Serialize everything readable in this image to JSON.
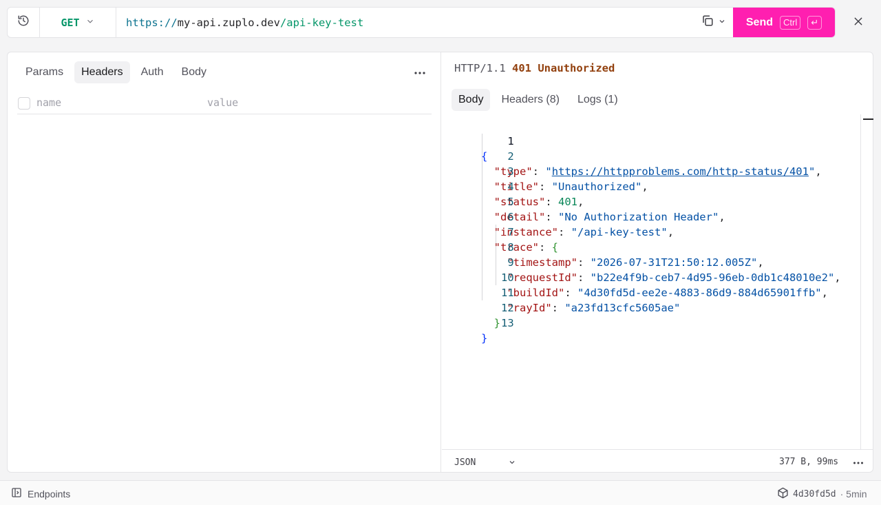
{
  "request": {
    "method": "GET",
    "url_scheme": "https://",
    "url_host": "my-api.zuplo.dev",
    "url_path": "/api-key-test",
    "send_label": "Send",
    "send_shortcut": "Ctrl",
    "send_shortcut_key": "↵"
  },
  "request_tabs": [
    {
      "label": "Params",
      "active": false
    },
    {
      "label": "Headers",
      "active": true
    },
    {
      "label": "Auth",
      "active": false
    },
    {
      "label": "Body",
      "active": false
    }
  ],
  "headers_table": {
    "name_placeholder": "name",
    "value_placeholder": "value"
  },
  "response": {
    "protocol": "HTTP/1.1",
    "status_code": "401",
    "status_text": "Unauthorized",
    "tabs": [
      {
        "label": "Body",
        "active": true
      },
      {
        "label": "Headers (8)",
        "active": false
      },
      {
        "label": "Logs (1)",
        "active": false
      }
    ],
    "line_numbers": [
      "1",
      "2",
      "3",
      "4",
      "5",
      "6",
      "7",
      "8",
      "9",
      "10",
      "11",
      "12",
      "13"
    ],
    "body": {
      "type": "https://httpproblems.com/http-status/401",
      "title": "Unauthorized",
      "status": "401",
      "detail": "No Authorization Header",
      "instance": "/api-key-test",
      "trace": {
        "timestamp": "2026-07-31T21:50:12.005Z",
        "requestId": "b22e4f9b-ceb7-4d95-96eb-0db1c48010e2",
        "buildId": "4d30fd5d-ee2e-4883-86d9-884d65901ffb",
        "rayId": "a23fd13cfc5605ae"
      }
    },
    "format": "JSON",
    "size_time": "377 B, 99ms"
  },
  "statusbar": {
    "endpoints_label": "Endpoints",
    "build_hash": "4d30fd5d",
    "build_age": "· 5min"
  },
  "colors": {
    "send_button": "#ff1fb0",
    "method_get": "#059669",
    "status_code": "#92400e"
  },
  "icons": [
    "history-icon",
    "chevron-down-icon",
    "copy-icon",
    "close-icon",
    "more-horizontal-icon",
    "sidebar-panel-icon",
    "cube-icon"
  ]
}
